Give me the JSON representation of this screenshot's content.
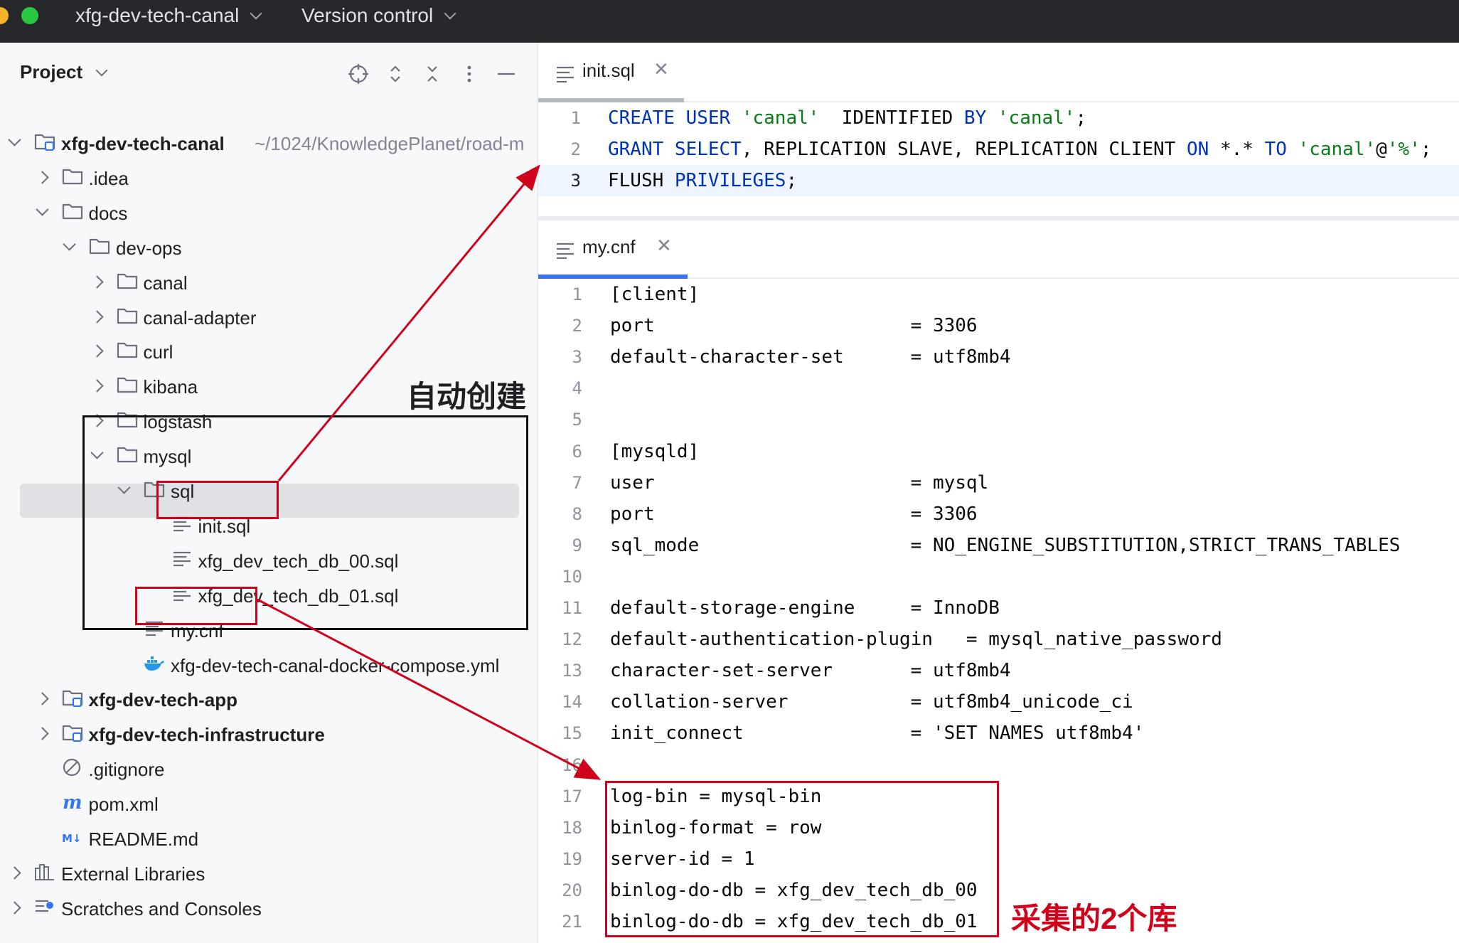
{
  "titlebar": {
    "project_name": "xfg-dev-tech-canal",
    "vcs_label": "Version control"
  },
  "project_panel": {
    "title": "Project",
    "tree": [
      {
        "label": "xfg-dev-tech-canal",
        "hint": "~/1024/KnowledgePlanet/road-m",
        "bold": true
      },
      {
        "label": ".idea"
      },
      {
        "label": "docs"
      },
      {
        "label": "dev-ops"
      },
      {
        "label": "canal"
      },
      {
        "label": "canal-adapter"
      },
      {
        "label": "curl"
      },
      {
        "label": "kibana"
      },
      {
        "label": "logstash"
      },
      {
        "label": "mysql"
      },
      {
        "label": "sql"
      },
      {
        "label": "init.sql"
      },
      {
        "label": "xfg_dev_tech_db_00.sql"
      },
      {
        "label": "xfg_dev_tech_db_01.sql"
      },
      {
        "label": "my.cnf"
      },
      {
        "label": "xfg-dev-tech-canal-docker-compose.yml"
      },
      {
        "label": "xfg-dev-tech-app",
        "bold": true
      },
      {
        "label": "xfg-dev-tech-infrastructure",
        "bold": true
      },
      {
        "label": ".gitignore"
      },
      {
        "label": "pom.xml"
      },
      {
        "label": "README.md"
      },
      {
        "label": "External Libraries"
      },
      {
        "label": "Scratches and Consoles"
      }
    ]
  },
  "editor_top": {
    "tab_label": "init.sql",
    "lines": [
      {
        "n": "1",
        "tokens": [
          [
            "kw",
            "CREATE USER "
          ],
          [
            "str",
            "'canal'"
          ],
          [
            "",
            "  IDENTIFIED "
          ],
          [
            "kw",
            "BY "
          ],
          [
            "str",
            "'canal'"
          ],
          [
            "",
            ";"
          ]
        ]
      },
      {
        "n": "2",
        "tokens": [
          [
            "kw",
            "GRANT SELECT"
          ],
          [
            "",
            ", REPLICATION SLAVE, REPLICATION CLIENT "
          ],
          [
            "kw",
            "ON "
          ],
          [
            "",
            "*.* "
          ],
          [
            "kw",
            "TO "
          ],
          [
            "str",
            "'canal'"
          ],
          [
            "",
            "@"
          ],
          [
            "str",
            "'%'"
          ],
          [
            "",
            ";"
          ]
        ]
      },
      {
        "n": "3",
        "tokens": [
          [
            "",
            "FLUSH "
          ],
          [
            "kw",
            "PRIVILEGES"
          ],
          [
            "",
            ";"
          ]
        ]
      }
    ]
  },
  "editor_bottom": {
    "tab_label": "my.cnf",
    "lines": [
      {
        "n": "1",
        "text": "[client]"
      },
      {
        "n": "2",
        "text": "port                       = 3306"
      },
      {
        "n": "3",
        "text": "default-character-set      = utf8mb4"
      },
      {
        "n": "4",
        "text": ""
      },
      {
        "n": "5",
        "text": ""
      },
      {
        "n": "6",
        "text": "[mysqld]"
      },
      {
        "n": "7",
        "text": "user                       = mysql"
      },
      {
        "n": "8",
        "text": "port                       = 3306"
      },
      {
        "n": "9",
        "text": "sql_mode                   = NO_ENGINE_SUBSTITUTION,STRICT_TRANS_TABLES"
      },
      {
        "n": "10",
        "text": ""
      },
      {
        "n": "11",
        "text": "default-storage-engine     = InnoDB"
      },
      {
        "n": "12",
        "text": "default-authentication-plugin   = mysql_native_password"
      },
      {
        "n": "13",
        "text": "character-set-server       = utf8mb4"
      },
      {
        "n": "14",
        "text": "collation-server           = utf8mb4_unicode_ci"
      },
      {
        "n": "15",
        "text": "init_connect               = 'SET NAMES utf8mb4'"
      },
      {
        "n": "16",
        "text": ""
      },
      {
        "n": "17",
        "text": "log-bin = mysql-bin"
      },
      {
        "n": "18",
        "text": "binlog-format = row"
      },
      {
        "n": "19",
        "text": "server-id = 1"
      },
      {
        "n": "20",
        "text": "binlog-do-db = xfg_dev_tech_db_00"
      },
      {
        "n": "21",
        "text": "binlog-do-db = xfg_dev_tech_db_01"
      }
    ]
  },
  "annotations": {
    "auto_create": "自动创建",
    "collect_two_dbs": "采集的2个库"
  },
  "colors": {
    "accent": "#3574f0",
    "annotation_red": "#d0021b",
    "keyword": "#0033b3",
    "string": "#067d17"
  }
}
